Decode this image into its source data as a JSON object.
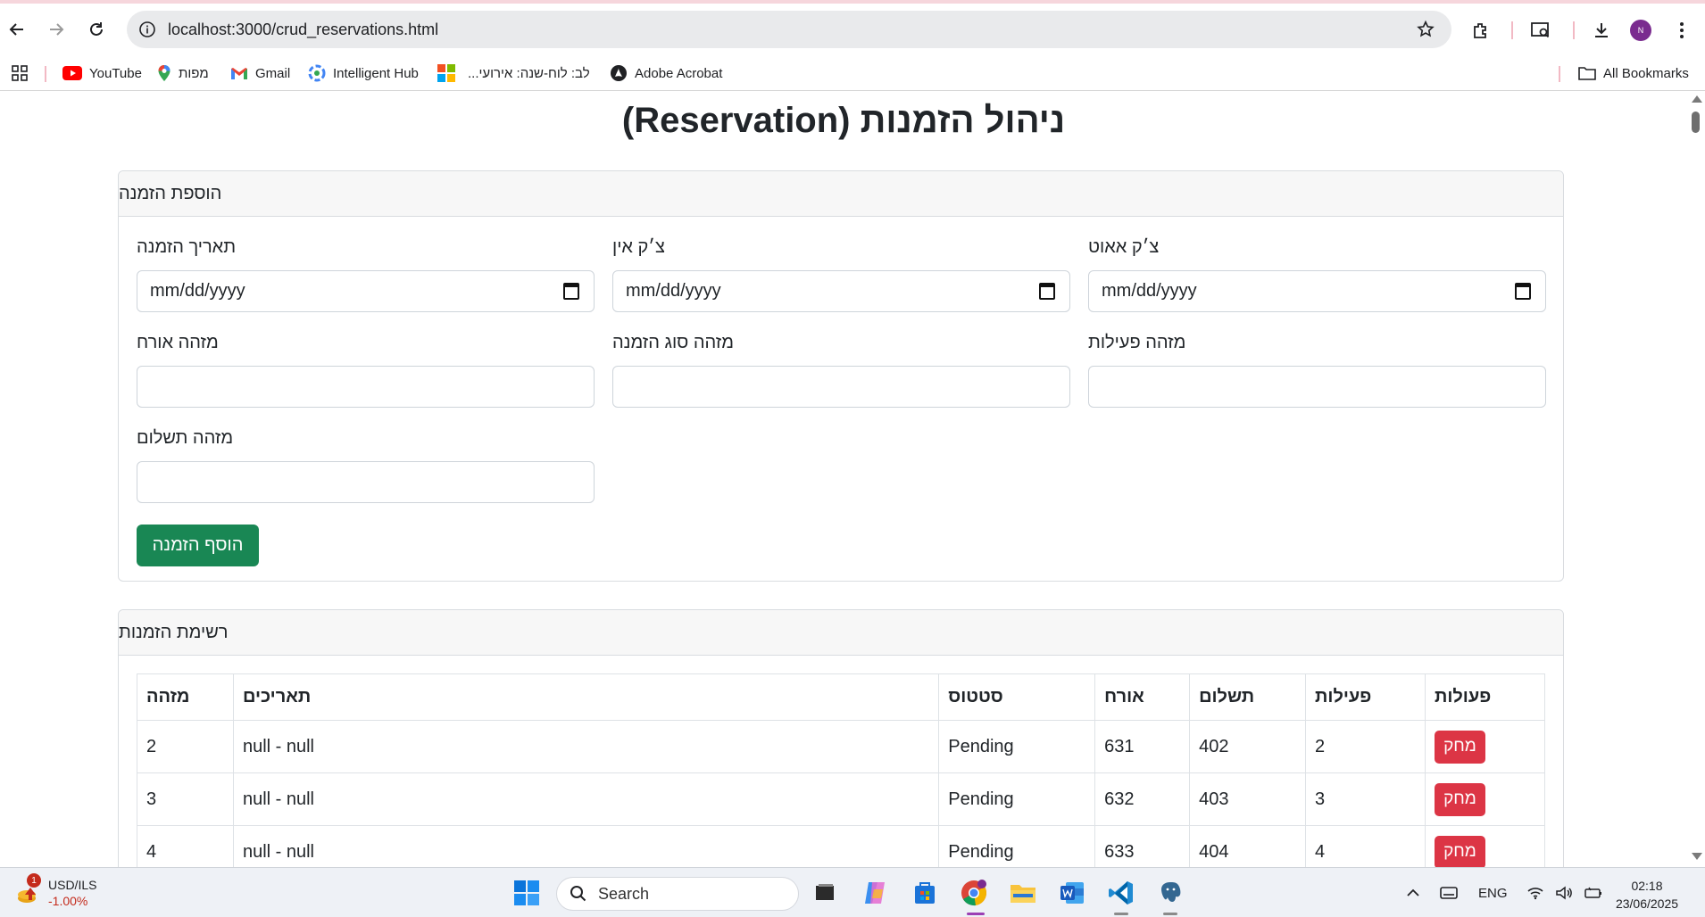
{
  "browser": {
    "url": "localhost:3000/crud_reservations.html",
    "profile_initial": "N",
    "bookmarks": [
      {
        "label": "YouTube",
        "icon": "youtube-icon"
      },
      {
        "label": "מפות",
        "icon": "maps-pin-icon"
      },
      {
        "label": "Gmail",
        "icon": "gmail-icon"
      },
      {
        "label": "Intelligent Hub",
        "icon": "intelligent-hub-icon"
      },
      {
        "label": "לב: לוח-שנה: אירועי...",
        "icon": "microsoft-icon"
      },
      {
        "label": "Adobe Acrobat",
        "icon": "acrobat-icon"
      }
    ],
    "all_bookmarks": "All Bookmarks"
  },
  "page": {
    "title": "ניהול הזמנות (Reservation)",
    "add_form": {
      "header": "הוספת הזמנה",
      "fields": {
        "booking_date": {
          "label": "תאריך הזמנה",
          "value": "mm/dd/yyyy"
        },
        "check_in": {
          "label": "צ׳ק אין",
          "value": "mm/dd/yyyy"
        },
        "check_out": {
          "label": "צ׳ק אאוט",
          "value": "mm/dd/yyyy"
        },
        "guest_id": {
          "label": "מזהה אורח",
          "value": ""
        },
        "booking_type_id": {
          "label": "מזהה סוג הזמנה",
          "value": ""
        },
        "activities_id": {
          "label": "מזהה פעילות",
          "value": ""
        },
        "payment_id": {
          "label": "מזהה תשלום",
          "value": ""
        }
      },
      "submit_label": "הוסף הזמנה"
    },
    "list": {
      "header": "רשימת הזמנות",
      "columns": [
        "מזהה",
        "תאריכים",
        "סטטוס",
        "אורח",
        "תשלום",
        "פעילות",
        "פעולות"
      ],
      "rows": [
        {
          "id": "2",
          "dates": "null - null",
          "status": "Pending",
          "guest": "631",
          "payment": "402",
          "activity": "2",
          "action": "מחק"
        },
        {
          "id": "3",
          "dates": "null - null",
          "status": "Pending",
          "guest": "632",
          "payment": "403",
          "activity": "3",
          "action": "מחק"
        },
        {
          "id": "4",
          "dates": "null - null",
          "status": "Pending",
          "guest": "633",
          "payment": "404",
          "activity": "4",
          "action": "מחק"
        }
      ]
    }
  },
  "taskbar": {
    "ticker_symbol": "USD/ILS",
    "ticker_change": "-1.00%",
    "ticker_badge": "1",
    "search_placeholder": "Search",
    "language": "ENG",
    "time": "02:18",
    "date": "23/06/2025"
  },
  "colors": {
    "success": "#198754",
    "danger": "#dc3545",
    "ticker_negative": "#c42b1c"
  }
}
